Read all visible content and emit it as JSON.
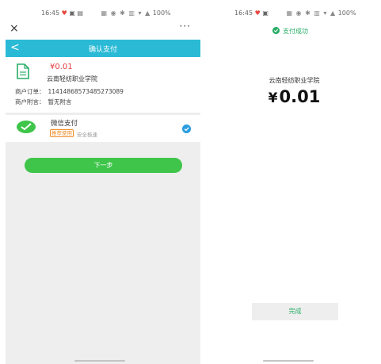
{
  "left": {
    "status": {
      "time": "16:45",
      "right": "100%"
    },
    "nav": {
      "close": "×",
      "more": "···"
    },
    "header": {
      "back": "<",
      "title": "确认支付"
    },
    "order": {
      "amount": "¥0.01",
      "merchant": "云南轻纺职业学院",
      "order_label": "商户订单：",
      "order_value": "1141486857348527308​9",
      "note_label": "商户附言：",
      "note_value": "暂无附言"
    },
    "payment": {
      "method": "微信支付",
      "badge": "推荐使用",
      "sub": "安全极速"
    },
    "next_button": "下一步"
  },
  "right": {
    "status": {
      "time": "16:45",
      "right": "100%"
    },
    "success_text": "支付成功",
    "merchant": "云南轻纺职业学院",
    "amount_symbol": "¥",
    "amount_value": "0.01",
    "done_button": "完成"
  },
  "colors": {
    "header": "#2bbad6",
    "next_button": "#3ec54a",
    "success": "#2aae67",
    "amount_red": "#e23c3c",
    "check": "#2b9de0"
  },
  "icons": [
    "close-icon",
    "more-icon",
    "back-arrow-icon",
    "document-icon",
    "wechat-pay-icon",
    "check-icon",
    "success-icon"
  ]
}
